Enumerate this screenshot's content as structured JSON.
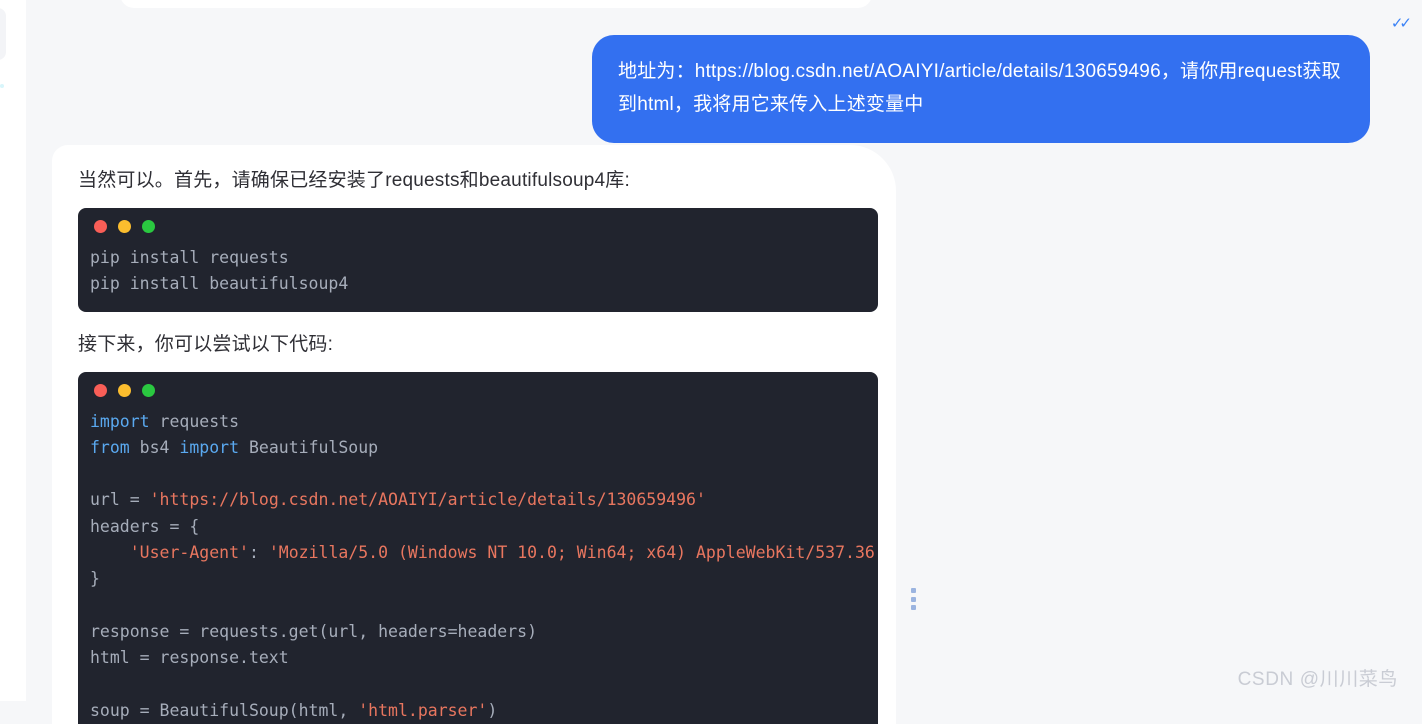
{
  "app": {
    "background_color": "#f6f7f9",
    "watermark": "CSDN @川川菜鸟"
  },
  "user_message": {
    "text": "地址为：https://blog.csdn.net/AOAIYI/article/details/130659496，请你用request获取到html，我将用它来传入上述变量中",
    "bubble_color": "#3370f0",
    "read_receipt_icon": "double-check-icon",
    "read_receipt_glyph": "✓✓"
  },
  "assistant_message": {
    "paragraph_1": "当然可以。首先，请确保已经安装了requests和beautifulsoup4库:",
    "paragraph_2": "接下来，你可以尝试以下代码:",
    "code_block_1": {
      "language": "shell",
      "window_dots": [
        "red",
        "yellow",
        "green"
      ],
      "lines": [
        "pip install requests",
        "pip install beautifulsoup4"
      ]
    },
    "code_block_2": {
      "language": "python",
      "window_dots": [
        "red",
        "yellow",
        "green"
      ],
      "lines": [
        [
          {
            "t": "import",
            "c": "kw"
          },
          {
            "t": " requests",
            "c": "pl"
          }
        ],
        [
          {
            "t": "from",
            "c": "kw"
          },
          {
            "t": " bs4 ",
            "c": "pl"
          },
          {
            "t": "import",
            "c": "kw"
          },
          {
            "t": " BeautifulSoup",
            "c": "pl"
          }
        ],
        [],
        [
          {
            "t": "url = ",
            "c": "pl"
          },
          {
            "t": "'https://blog.csdn.net/AOAIYI/article/details/130659496'",
            "c": "str"
          }
        ],
        [
          {
            "t": "headers = {",
            "c": "pl"
          }
        ],
        [
          {
            "t": "    ",
            "c": "pl"
          },
          {
            "t": "'User-Agent'",
            "c": "str"
          },
          {
            "t": ": ",
            "c": "pl"
          },
          {
            "t": "'Mozilla/5.0 (Windows NT 10.0; Win64; x64) AppleWebKit/537.36",
            "c": "str"
          }
        ],
        [
          {
            "t": "}",
            "c": "pl"
          }
        ],
        [],
        [
          {
            "t": "response = requests.get(url, headers=headers)",
            "c": "pl"
          }
        ],
        [
          {
            "t": "html = response.text",
            "c": "pl"
          }
        ],
        [],
        [
          {
            "t": "soup = BeautifulSoup(html, ",
            "c": "pl"
          },
          {
            "t": "'html.parser'",
            "c": "str"
          },
          {
            "t": ")",
            "c": "pl"
          }
        ]
      ]
    }
  },
  "drag_handle": {
    "icon": "vertical-dots-grip-icon",
    "dot_color": "#9bb4e0"
  },
  "colors": {
    "code_background": "#21242e",
    "code_text": "#a6adba",
    "keyword": "#5aa9f0",
    "string": "#e8765f",
    "accent_blue": "#3370f0",
    "dot_red": "#f95e57",
    "dot_yellow": "#fbbd2e",
    "dot_green": "#2ac840"
  }
}
